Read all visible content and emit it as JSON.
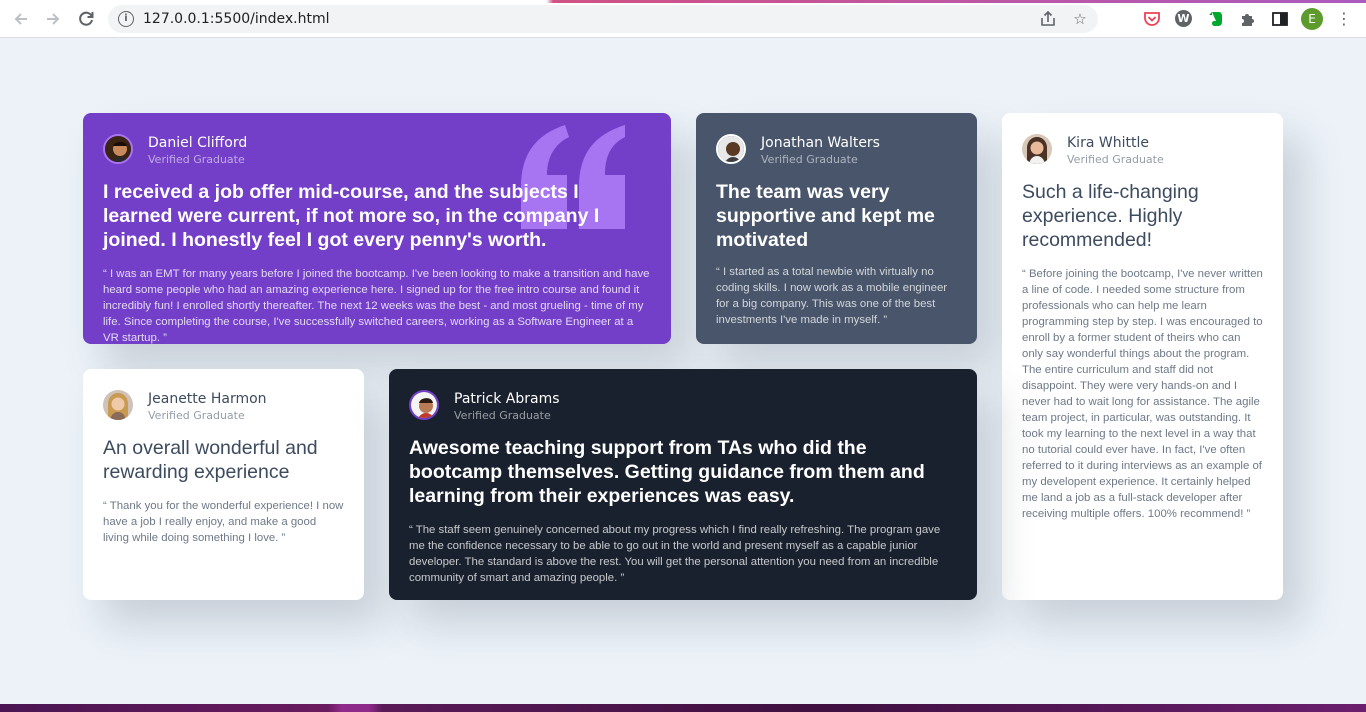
{
  "browser": {
    "url_host": "127.0.0.1",
    "url_path": ":5500/index.html",
    "profile_initial": "E",
    "accent_colors": {
      "pocket": "#ef4056",
      "evernote": "#00a82d",
      "profile": "#5c9b2c"
    }
  },
  "testimonials": [
    {
      "name": "Daniel Clifford",
      "status": "Verified Graduate",
      "headline": "I received a job offer mid-course, and the subjects I learned were current, if not more so, in the company I joined. I honestly feel I got every penny's worth.",
      "quote": "“ I was an EMT for many years before I joined the bootcamp. I've been looking to make a transition and have heard some people who had an amazing experience here. I signed up for the free intro course and found it incredibly fun! I enrolled shortly thereafter. The next 12 weeks was the best - and most grueling - time of my life. Since completing the course, I've successfully switched careers, working as a Software Engineer at a VR startup. ”",
      "bg": "#733fc8"
    },
    {
      "name": "Jonathan Walters",
      "status": "Verified Graduate",
      "headline": "The team was very supportive and kept me motivated",
      "quote": "“ I started as a total newbie with virtually no coding skills. I now work as a mobile engineer for a big company. This was one of the best investments I've made in myself. ”",
      "bg": "#48556a"
    },
    {
      "name": "Kira Whittle",
      "status": "Verified Graduate",
      "headline": "Such a life-changing experience. Highly recommended!",
      "quote": "“ Before joining the bootcamp, I've never written a line of code. I needed some structure from professionals who can help me learn programming step by step. I was encouraged to enroll by a former student of theirs who can only say wonderful things about the program. The entire curriculum and staff did not disappoint. They were very hands-on and I never had to wait long for assistance. The agile team project, in particular, was outstanding. It took my learning to the next level in a way that no tutorial could ever have. In fact, I've often referred to it during interviews as an example of my developent experience. It certainly helped me land a job as a full-stack developer after receiving multiple offers. 100% recommend! ”",
      "bg": "#ffffff"
    },
    {
      "name": "Jeanette Harmon",
      "status": "Verified Graduate",
      "headline": "An overall wonderful and rewarding experience",
      "quote": "“ Thank you for the wonderful experience! I now have a job I really enjoy, and make a good living while doing something I love. ”",
      "bg": "#ffffff"
    },
    {
      "name": "Patrick Abrams",
      "status": "Verified Graduate",
      "headline": "Awesome teaching support from TAs who did the bootcamp themselves. Getting guidance from them and learning from their experiences was easy.",
      "quote": "“ The staff seem genuinely concerned about my progress which I find really refreshing. The program gave me the confidence necessary to be able to go out in the world and present myself as a capable junior developer. The standard is above the rest. You will get the personal attention you need from an incredible community of smart and amazing people. ”",
      "bg": "#19212e"
    }
  ],
  "icons": {
    "back": "arrow-left",
    "forward": "arrow-right",
    "reload": "reload",
    "info": "info",
    "share": "share",
    "bookmark": "star",
    "pocket": "pocket",
    "wordpress": "wordpress",
    "evernote": "evernote",
    "extensions": "puzzle",
    "side_panel": "side-panel",
    "menu": "kebab-menu",
    "quote_mark": "quotation-mark"
  }
}
